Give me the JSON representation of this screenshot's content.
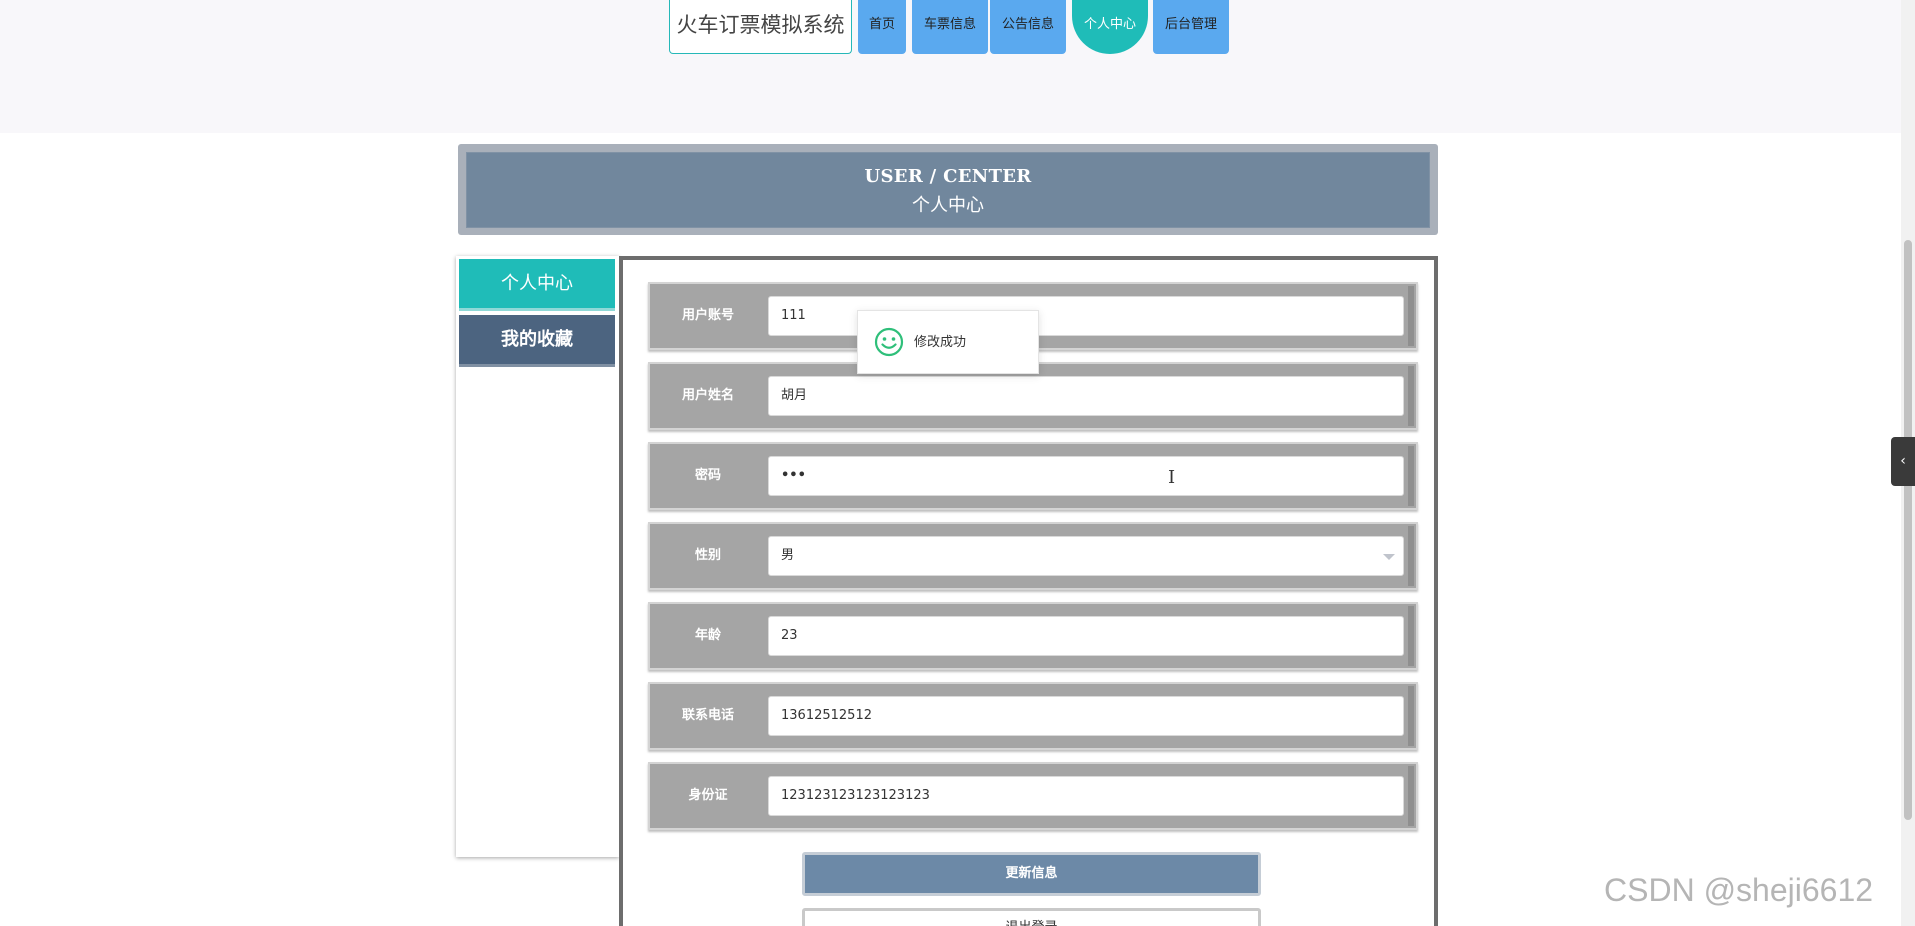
{
  "header": {
    "site_title": "火车订票模拟系统",
    "nav": [
      {
        "label": "首页",
        "active": false
      },
      {
        "label": "车票信息",
        "active": false
      },
      {
        "label": "公告信息",
        "active": false
      },
      {
        "label": "个人中心",
        "active": true
      },
      {
        "label": "后台管理",
        "active": false
      }
    ]
  },
  "banner": {
    "title_en": "USER / CENTER",
    "title_cn": "个人中心"
  },
  "sidebar": {
    "items": [
      {
        "label": "个人中心",
        "active": true
      },
      {
        "label": "我的收藏",
        "active": false
      }
    ]
  },
  "form": {
    "fields": [
      {
        "label": "用户账号",
        "value": "111"
      },
      {
        "label": "用户姓名",
        "value": "胡月"
      },
      {
        "label": "密码",
        "value": "•••"
      },
      {
        "label": "性别",
        "value": "男"
      },
      {
        "label": "年龄",
        "value": "23"
      },
      {
        "label": "联系电话",
        "value": "13612512512"
      },
      {
        "label": "身份证",
        "value": "123123123123123123"
      }
    ],
    "update_button": "更新信息",
    "logout_button": "退出登录"
  },
  "toast": {
    "message": "修改成功",
    "icon": "smile-icon"
  },
  "side_tab": {
    "glyph": "‹"
  },
  "cursor": {
    "glyph": "I"
  },
  "watermark": "CSDN @sheji6612",
  "colors": {
    "accent_teal": "#1fbcb8",
    "nav_blue": "#5aa9ef",
    "banner_slate": "#71879d",
    "sidebar_dark": "#4c6480",
    "update_button": "#6c89a7"
  }
}
